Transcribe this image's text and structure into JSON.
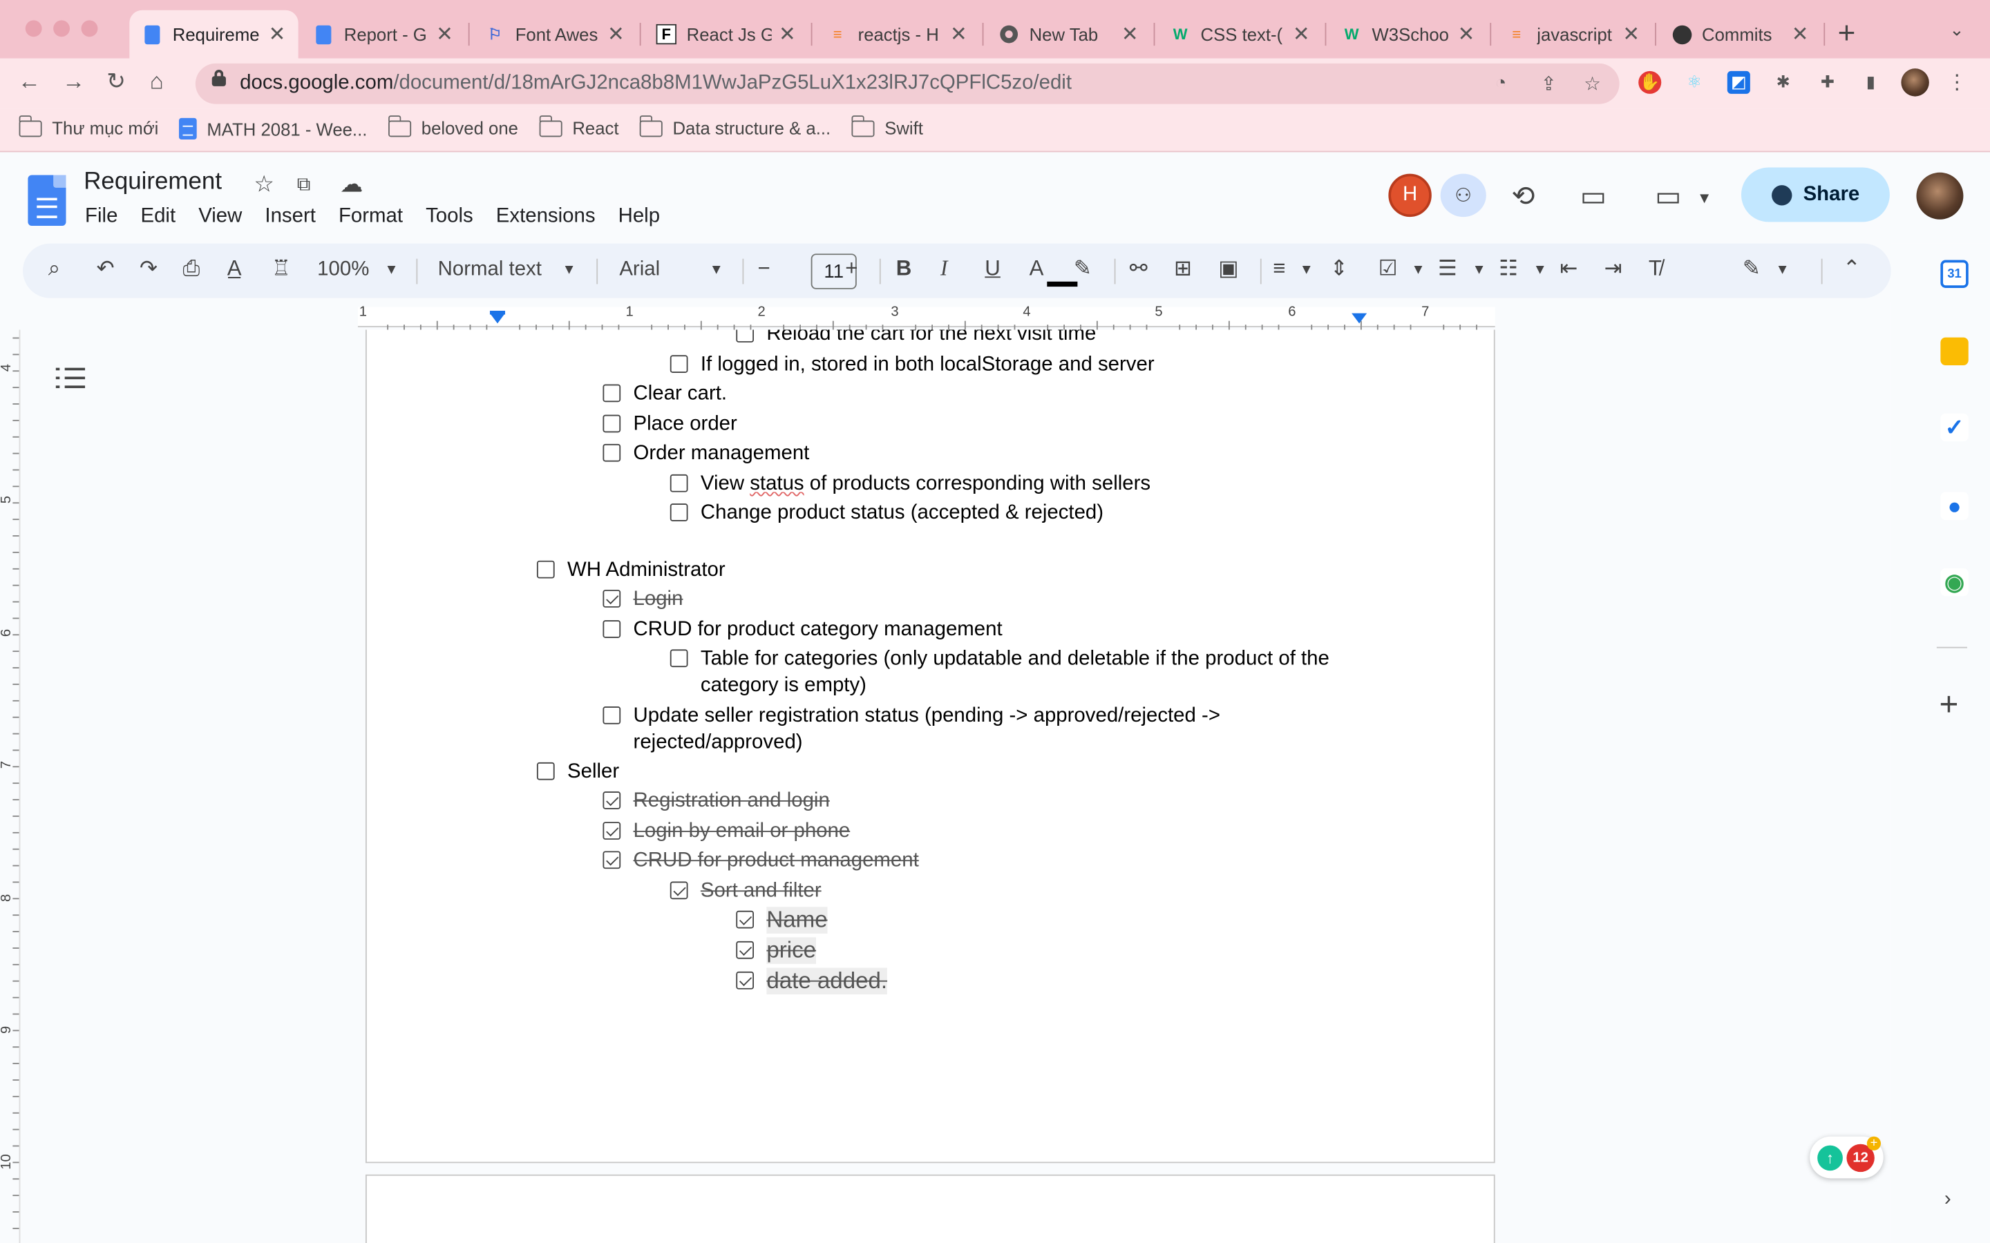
{
  "browser": {
    "tabs": [
      {
        "title": "Requireme",
        "icon": "docs-icon",
        "active": true
      },
      {
        "title": "Report - G",
        "icon": "docs-icon"
      },
      {
        "title": "Font Awes",
        "icon": "flag-icon"
      },
      {
        "title": "React Js G",
        "icon": "f-icon"
      },
      {
        "title": "reactjs - H",
        "icon": "stackoverflow-icon"
      },
      {
        "title": "New Tab",
        "icon": "chrome-icon"
      },
      {
        "title": "CSS text-(",
        "icon": "w3schools-icon"
      },
      {
        "title": "W3Schoo",
        "icon": "w3schools-icon"
      },
      {
        "title": "javascript",
        "icon": "stackoverflow-icon"
      },
      {
        "title": "Commits",
        "icon": "github-icon"
      }
    ],
    "url_host": "docs.google.com",
    "url_path": "/document/d/18mArGJ2nca8b8M1WwJaPzG5LuX1x23lRJ7cQPFlC5zo/edit",
    "bookmarks": [
      {
        "label": "Thư mục mới",
        "icon": "folder-icon"
      },
      {
        "label": "MATH 2081 - Wee...",
        "icon": "docs-icon"
      },
      {
        "label": "beloved one",
        "icon": "folder-icon"
      },
      {
        "label": "React",
        "icon": "folder-icon"
      },
      {
        "label": "Data structure & a...",
        "icon": "folder-icon"
      },
      {
        "label": "Swift",
        "icon": "folder-icon"
      }
    ]
  },
  "docs": {
    "title": "Requirement",
    "menu": [
      "File",
      "Edit",
      "View",
      "Insert",
      "Format",
      "Tools",
      "Extensions",
      "Help"
    ],
    "avatar_initial": "H",
    "share_label": "Share",
    "toolbar": {
      "zoom": "100%",
      "style": "Normal text",
      "font": "Arial",
      "font_size": "11"
    },
    "ruler_numbers": [
      "1",
      "1",
      "2",
      "3",
      "4",
      "5",
      "6",
      "7"
    ],
    "vruler_numbers": [
      "4",
      "5",
      "6",
      "7",
      "8",
      "9",
      "10"
    ],
    "colors": {
      "accent": "#1a73e8",
      "tabbar": "#f3c3cd",
      "share": "#c2e7ff",
      "avatar": "#e0512c"
    }
  },
  "content": {
    "items": [
      {
        "text": "Reload the cart for the next visit time",
        "checked": false
      },
      {
        "text": "If logged in, stored in both localStorage and server",
        "checked": false
      },
      {
        "text": "Clear cart.",
        "checked": false
      },
      {
        "text": "Place order",
        "checked": false
      },
      {
        "text": "Order management",
        "checked": false
      },
      {
        "text_before": "View ",
        "text_spell": "status",
        "text_after": " of products corresponding with sellers",
        "checked": false
      },
      {
        "text": "Change product status (accepted & rejected)",
        "checked": false
      },
      {
        "text": "WH Administrator",
        "checked": false
      },
      {
        "text": "Login",
        "checked": true
      },
      {
        "text": "CRUD for product category management",
        "checked": false
      },
      {
        "text": "Table for categories (only updatable and deletable if the product of the category is empty)",
        "checked": false
      },
      {
        "text": "Update seller registration status (pending -> approved/rejected -> rejected/approved)",
        "checked": false
      },
      {
        "text": "Seller",
        "checked": false
      },
      {
        "text": "Registration and login",
        "checked": true
      },
      {
        "text": "Login by email or phone",
        "checked": true
      },
      {
        "text": "CRUD for product management",
        "checked": true
      },
      {
        "text": "Sort and filter",
        "checked": true
      },
      {
        "text": "Name",
        "checked": true
      },
      {
        "text": "price",
        "checked": true
      },
      {
        "text": "date added.",
        "checked": true
      }
    ]
  },
  "side_panel": {
    "calendar_day": "31",
    "grammarly_count": "12"
  }
}
